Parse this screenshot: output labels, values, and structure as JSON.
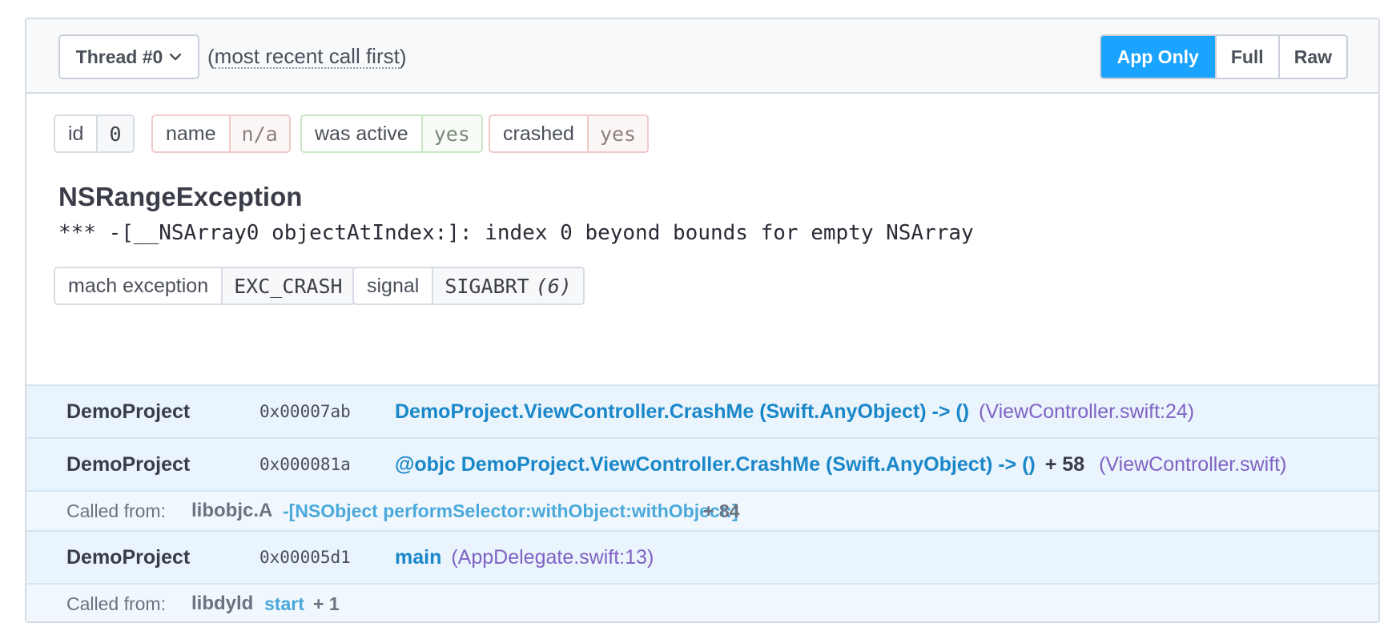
{
  "header": {
    "thread_label": "Thread #0",
    "order_hint_open": "(",
    "order_hint_text": "most recent call first",
    "order_hint_close": ")",
    "view_modes": [
      "App Only",
      "Full",
      "Raw"
    ],
    "active_view": "App Only"
  },
  "thread_info": [
    {
      "key": "id",
      "value": "0",
      "tone": "neutral"
    },
    {
      "key": "name",
      "value": "n/a",
      "tone": "red"
    },
    {
      "key": "was active",
      "value": "yes",
      "tone": "green"
    },
    {
      "key": "crashed",
      "value": "yes",
      "tone": "red"
    }
  ],
  "exception": {
    "type": "NSRangeException",
    "message": "*** -[__NSArray0 objectAtIndex:]: index 0 beyond bounds for empty NSArray",
    "mach_exception": {
      "key": "mach exception",
      "value": "EXC_CRASH"
    },
    "signal": {
      "key": "signal",
      "value": "SIGABRT",
      "code": "(6)"
    }
  },
  "frames": [
    {
      "package": "DemoProject",
      "address": "0x00007ab",
      "function": "DemoProject.ViewController.CrashMe (Swift.AnyObject) -> ()",
      "offset": "",
      "location": "(ViewController.swift:24)"
    },
    {
      "package": "DemoProject",
      "address": "0x000081a",
      "function": "@objc DemoProject.ViewController.CrashMe (Swift.AnyObject) -> ()",
      "offset": "+ 58",
      "location": "(ViewController.swift)"
    },
    {
      "called_from": true,
      "label": "Called from:",
      "package": "libobjc.A",
      "function": "-[NSObject performSelector:withObject:withObject:]",
      "offset": "+ 84"
    },
    {
      "package": "DemoProject",
      "address": "0x00005d1",
      "function": "main",
      "offset": "",
      "location": "(AppDelegate.swift:13)"
    },
    {
      "called_from": true,
      "label": "Called from:",
      "package": "libdyld",
      "function": "start",
      "offset": "+ 1"
    }
  ],
  "colors": {
    "accent": "#1aa3ff",
    "function_link": "#1a87c9",
    "location": "#7f62c4",
    "frame_bg": "#eaf4fc"
  }
}
